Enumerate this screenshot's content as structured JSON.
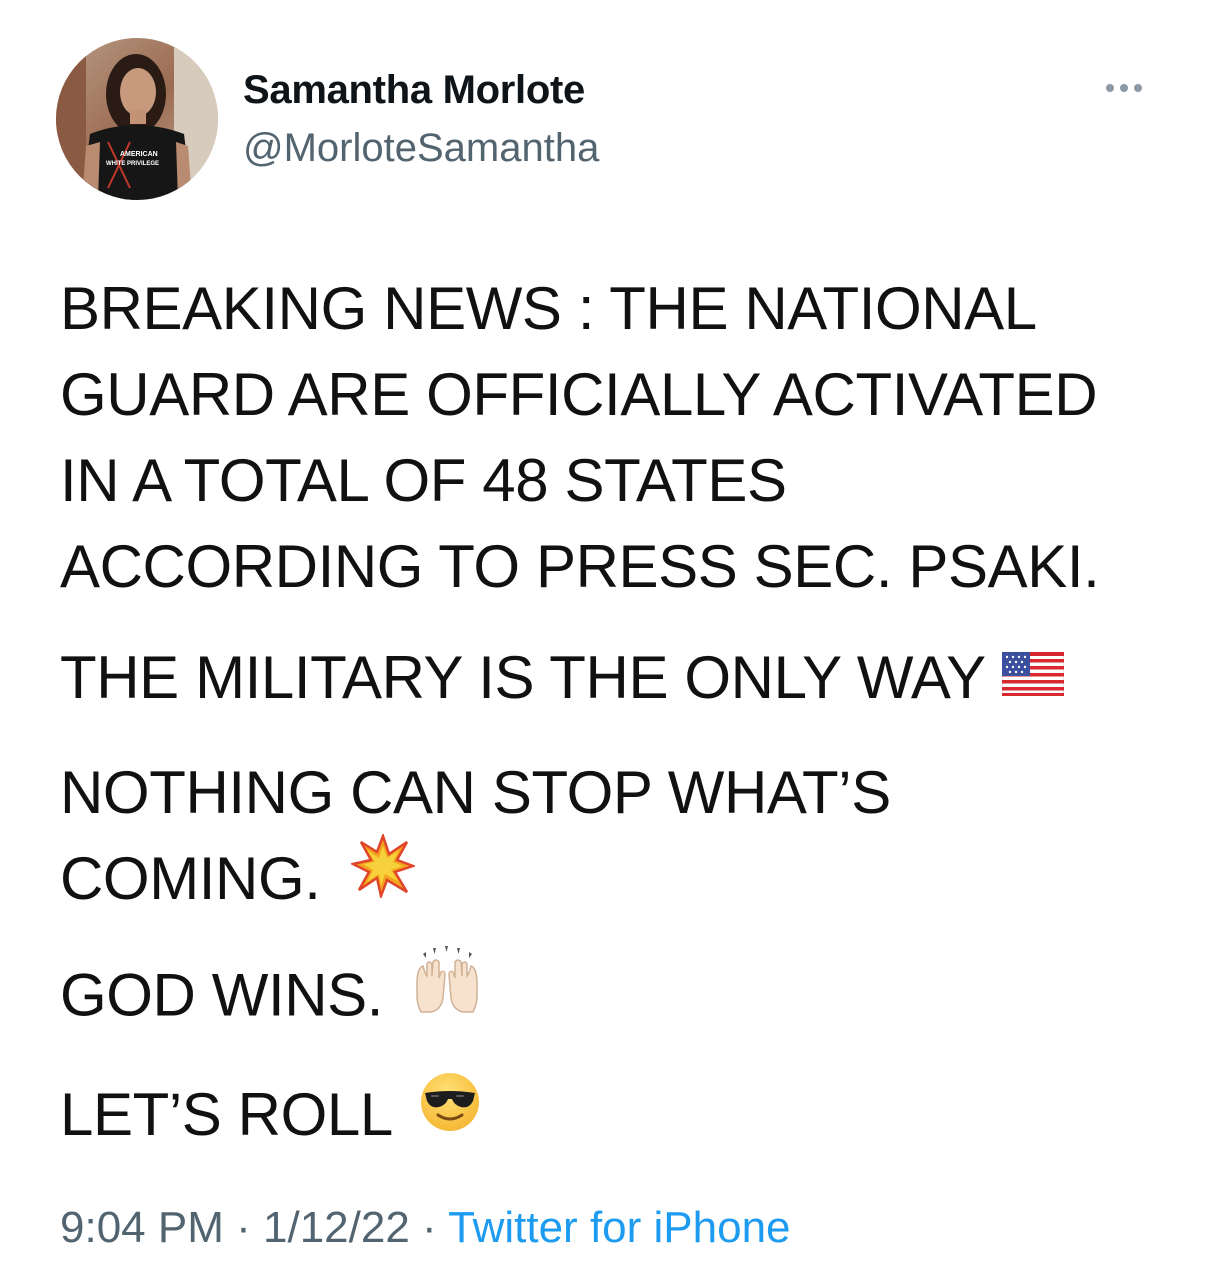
{
  "author": {
    "name": "Samantha Morlote",
    "handle": "@MorloteSamantha",
    "avatar_shirt_text_line1": "AMERICAN",
    "avatar_shirt_text_line2": "WHITE PRIVILEGE"
  },
  "tweet": {
    "line1": "BREAKING NEWS : THE NATIONAL",
    "line2": "GUARD ARE OFFICIALLY ACTIVATED",
    "line3": "IN A TOTAL OF 48 STATES",
    "line4": "ACCORDING TO PRESS SEC. PSAKI.",
    "line5": "THE MILITARY IS THE ONLY WAY",
    "line6": "NOTHING CAN STOP WHAT’S",
    "line7": "COMING.",
    "line8": "GOD WINS.",
    "line9": "LET’S ROLL",
    "emojis": {
      "flag": "us-flag-icon",
      "collision": "collision-icon",
      "raising_hands": "raising-hands-icon",
      "sunglasses": "sunglasses-face-icon"
    }
  },
  "meta": {
    "time": "9:04 PM",
    "separator": "·",
    "date": "1/12/22",
    "source": "Twitter for iPhone"
  },
  "colors": {
    "text": "#0f1419",
    "secondary": "#536471",
    "link": "#1d9bf0"
  }
}
